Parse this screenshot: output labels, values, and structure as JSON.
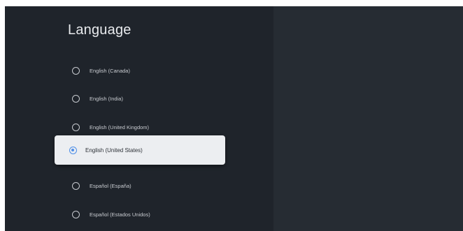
{
  "page": {
    "title": "Language"
  },
  "languages": [
    {
      "label": "English (Canada)",
      "selected": false
    },
    {
      "label": "English (India)",
      "selected": false
    },
    {
      "label": "English (United Kingdom)",
      "selected": false
    },
    {
      "label": "English (United States)",
      "selected": true
    },
    {
      "label": "Español (España)",
      "selected": false
    },
    {
      "label": "Español (Estados Unidos)",
      "selected": false
    }
  ],
  "colors": {
    "background": "#1f242b",
    "selected_background": "#eceef1",
    "accent": "#4f8fe8"
  },
  "icons": {
    "unselected": "radio-unchecked-icon",
    "selected": "radio-checked-icon"
  }
}
